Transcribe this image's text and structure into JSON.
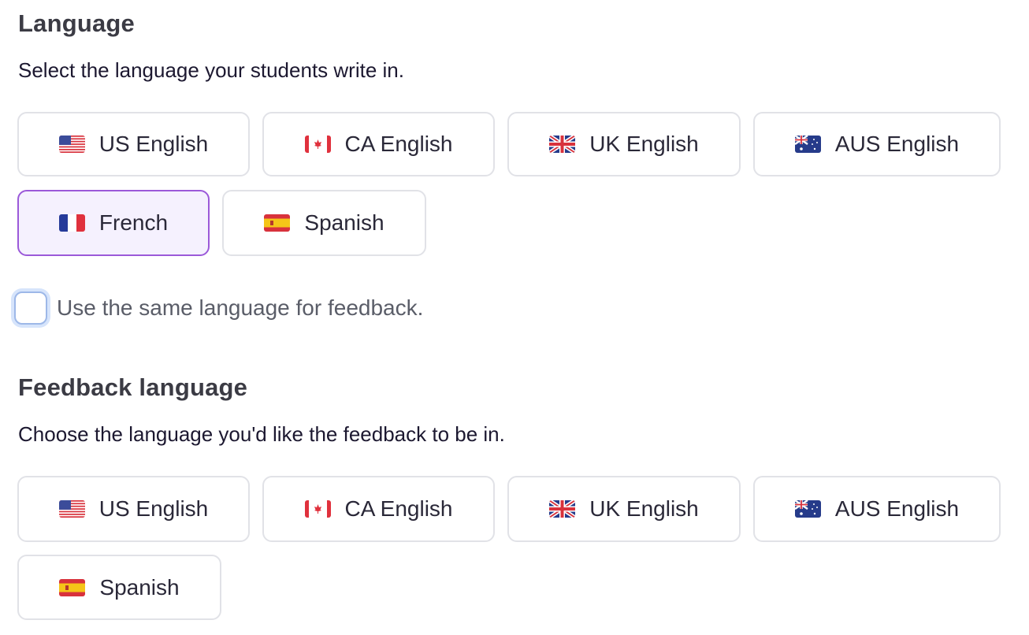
{
  "language_section": {
    "title": "Language",
    "description": "Select the language your students write in.",
    "options": [
      {
        "label": "US English",
        "flag": "us-flag-icon",
        "selected": false
      },
      {
        "label": "CA English",
        "flag": "ca-flag-icon",
        "selected": false
      },
      {
        "label": "UK English",
        "flag": "uk-flag-icon",
        "selected": false
      },
      {
        "label": "AUS English",
        "flag": "aus-flag-icon",
        "selected": false
      },
      {
        "label": "French",
        "flag": "fr-flag-icon",
        "selected": true
      },
      {
        "label": "Spanish",
        "flag": "es-flag-icon",
        "selected": false
      }
    ]
  },
  "same_language_checkbox": {
    "label": "Use the same language for feedback.",
    "checked": false
  },
  "feedback_section": {
    "title": "Feedback language",
    "description": "Choose the language you'd like the feedback to be in.",
    "options": [
      {
        "label": "US English",
        "flag": "us-flag-icon",
        "selected": false
      },
      {
        "label": "CA English",
        "flag": "ca-flag-icon",
        "selected": false
      },
      {
        "label": "UK English",
        "flag": "uk-flag-icon",
        "selected": false
      },
      {
        "label": "AUS English",
        "flag": "aus-flag-icon",
        "selected": false
      },
      {
        "label": "Spanish",
        "flag": "es-flag-icon",
        "selected": false
      }
    ]
  },
  "colors": {
    "selected_border": "#9b59d9",
    "selected_background": "#f5f1fe",
    "default_border": "#e1e2e7",
    "checkbox_focus_ring": "#d6e4fb"
  }
}
